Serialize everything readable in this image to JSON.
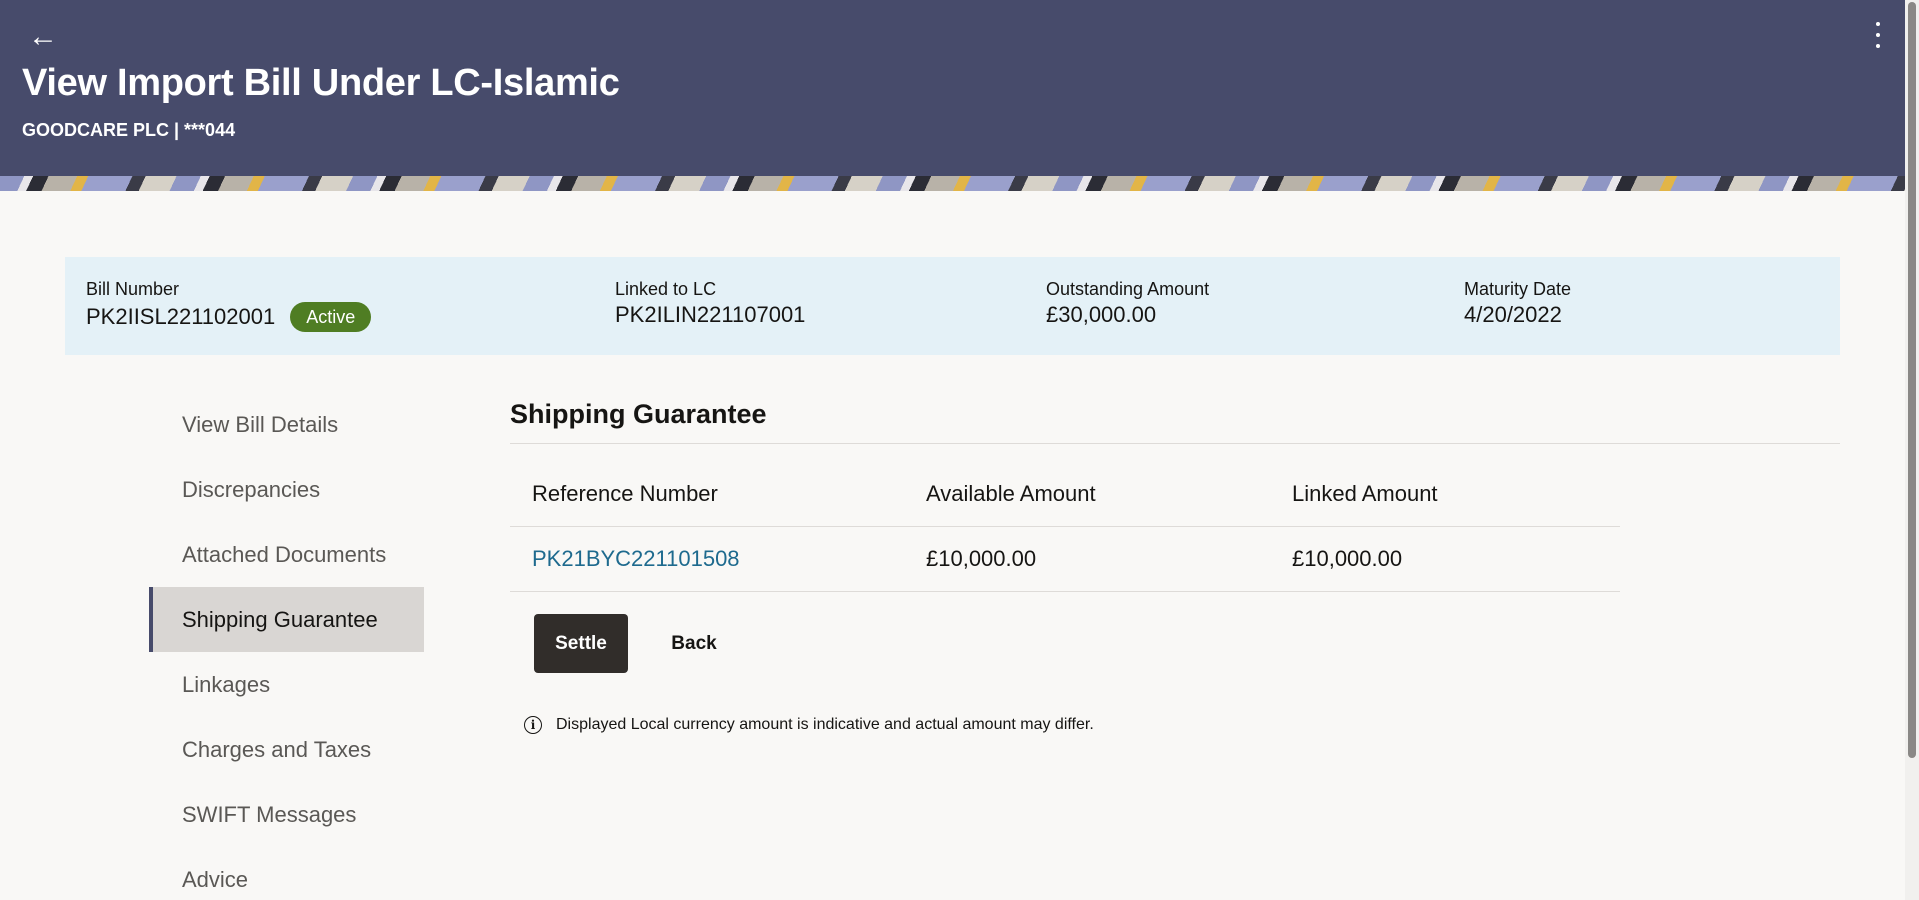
{
  "header": {
    "title": "View Import Bill Under LC-Islamic",
    "subtitle": "GOODCARE PLC | ***044",
    "back_icon": "←",
    "bg_color": "#474b6b"
  },
  "summary": {
    "bill_number": {
      "label": "Bill Number",
      "value": "PK2IISL221102001",
      "status": "Active"
    },
    "linked_lc": {
      "label": "Linked to LC",
      "value": "PK2ILIN221107001"
    },
    "outstanding": {
      "label": "Outstanding Amount",
      "value": "£30,000.00"
    },
    "maturity": {
      "label": "Maturity Date",
      "value": "4/20/2022"
    }
  },
  "sidenav": {
    "items": [
      {
        "label": "View Bill Details"
      },
      {
        "label": "Discrepancies"
      },
      {
        "label": "Attached Documents"
      },
      {
        "label": "Shipping Guarantee"
      },
      {
        "label": "Linkages"
      },
      {
        "label": "Charges and Taxes"
      },
      {
        "label": "SWIFT Messages"
      },
      {
        "label": "Advice"
      }
    ],
    "active_label": "Shipping Guarantee"
  },
  "section": {
    "title": "Shipping Guarantee",
    "columns": [
      "Reference Number",
      "Available Amount",
      "Linked Amount"
    ],
    "rows": [
      {
        "reference": "PK21BYC221101508",
        "available": "£10,000.00",
        "linked": "£10,000.00"
      }
    ]
  },
  "actions": {
    "settle_label": "Settle",
    "back_label": "Back"
  },
  "info": {
    "icon": "i",
    "text": "Displayed Local currency amount is indicative and actual amount may differ."
  }
}
